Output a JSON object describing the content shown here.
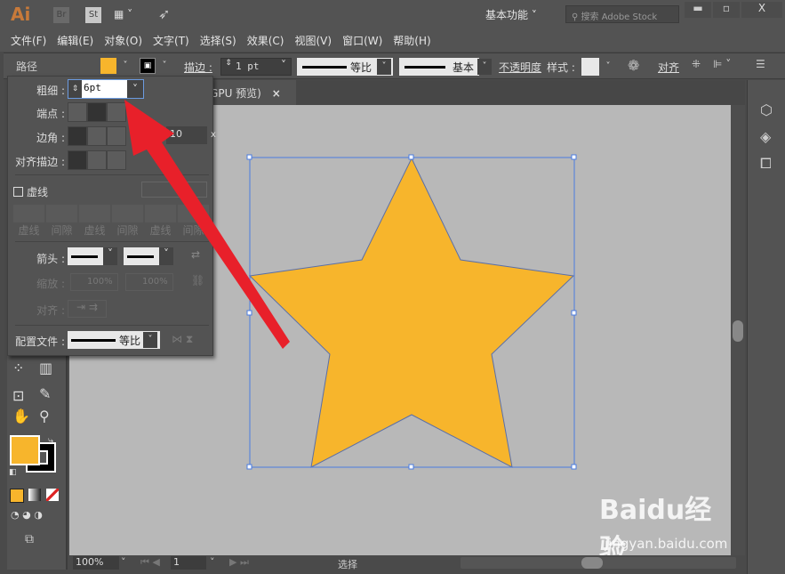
{
  "app": {
    "logo": "Ai",
    "bridge": "Br",
    "stock": "St",
    "workspace": "基本功能",
    "search_placeholder": "搜索 Adobe Stock",
    "window_controls": [
      "minimize",
      "maximize",
      "close"
    ]
  },
  "menu": [
    "文件(F)",
    "编辑(E)",
    "对象(O)",
    "文字(T)",
    "选择(S)",
    "效果(C)",
    "视图(V)",
    "窗口(W)",
    "帮助(H)"
  ],
  "control": {
    "object_type": "路径",
    "fill_color": "#F7B52C",
    "stroke_label": "描边 :",
    "stroke_weight": "1 pt",
    "profile": "等比",
    "brush": "基本",
    "opacity_label": "不透明度",
    "style_label": "样式 :",
    "align_label": "对齐"
  },
  "document_tab": {
    "title": "/GPU 预览)",
    "close": "×"
  },
  "stroke_panel": {
    "weight_label": "粗细 :",
    "weight_value": "6pt",
    "cap_label": "端点 :",
    "corner_label": "边角 :",
    "limit_value": "10",
    "limit_unit": "x",
    "align_label": "对齐描边 :",
    "dashed_label": "虚线",
    "dashed_checked": false,
    "dash_fields": [
      "虚线",
      "间隙",
      "虚线",
      "间隙",
      "虚线",
      "间隙"
    ],
    "arrow_label": "箭头 :",
    "scale_label": "缩放 :",
    "scale_values": [
      "100%",
      "100%"
    ],
    "arrow_align_label": "对齐 :",
    "profile_label": "配置文件 :",
    "profile_value": "等比"
  },
  "toolbox": {
    "fill_color": "#F7B52C",
    "stroke_color": "#000000"
  },
  "artwork": {
    "shape": "star",
    "fill": "#F7B52C",
    "stroke": "#5A6FA8",
    "selection_color": "#4A7BE0"
  },
  "annotation": {
    "arrow_color": "#E8202A"
  },
  "status": {
    "zoom": "100%",
    "artboard": "1",
    "tool": "选择"
  },
  "watermark": {
    "text": "Baidu经验",
    "url": "jingyan.baidu.com"
  }
}
